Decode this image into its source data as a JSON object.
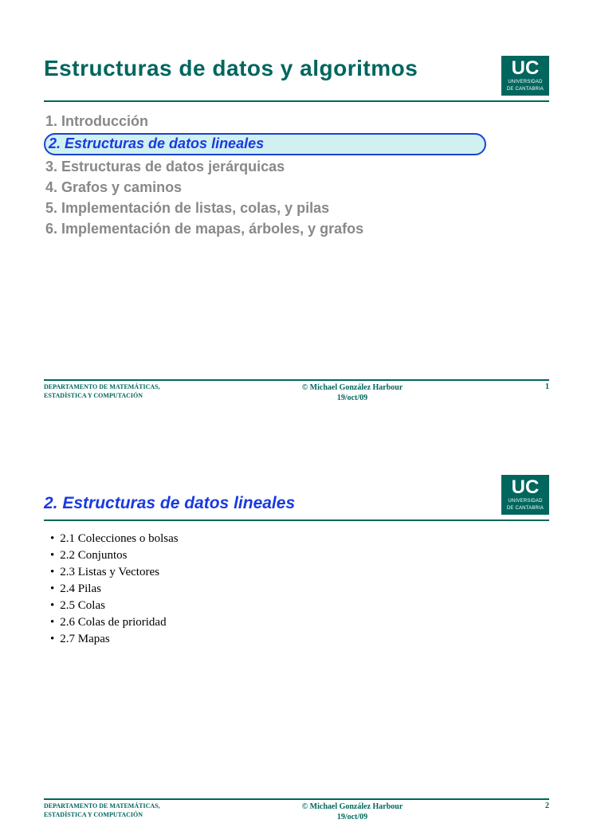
{
  "logo": {
    "big": "UC",
    "line1": "UNIVERSIDAD",
    "line2": "DE CANTABRIA"
  },
  "slide1": {
    "title": "Estructuras de datos y algoritmos",
    "toc": [
      "1. Introducción",
      "2. Estructuras de datos lineales",
      "3. Estructuras de datos jerárquicas",
      "4. Grafos y caminos",
      "5. Implementación de listas, colas, y pilas",
      "6. Implementación de mapas, árboles, y grafos"
    ],
    "highlight_index": 1,
    "footer_page": "1"
  },
  "slide2": {
    "title": "2. Estructuras de datos lineales",
    "items": [
      "2.1 Colecciones o bolsas",
      "2.2 Conjuntos",
      "2.3 Listas y Vectores",
      "2.4 Pilas",
      "2.5 Colas",
      "2.6 Colas de prioridad",
      "2.7 Mapas"
    ],
    "footer_page": "2"
  },
  "footer": {
    "dept_line1": "DEPARTAMENTO DE MATEMÁTICAS,",
    "dept_line2": "ESTADÍSTICA Y COMPUTACIÓN",
    "author": "© Michael González Harbour",
    "date": "19/oct/09"
  }
}
